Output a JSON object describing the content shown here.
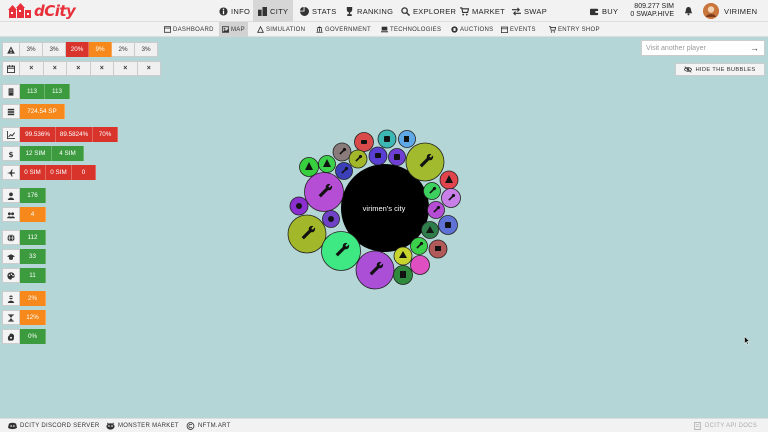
{
  "header": {
    "brand": "dCity",
    "nav": [
      {
        "label": "INFO",
        "icon": "info-icon"
      },
      {
        "label": "CITY",
        "icon": "city-icon",
        "active": true
      },
      {
        "label": "STATS",
        "icon": "stats-icon"
      },
      {
        "label": "RANKING",
        "icon": "trophy-icon"
      },
      {
        "label": "EXPLORER",
        "icon": "search-icon"
      },
      {
        "label": "MARKET",
        "icon": "cart-icon"
      },
      {
        "label": "SWAP",
        "icon": "swap-icon"
      },
      {
        "label": "BUY",
        "icon": "wallet-icon"
      }
    ],
    "balance_sim": "809.277 SIM",
    "balance_hive": "0 SWAP.HIVE",
    "username": "VIRIMEN"
  },
  "subnav": [
    {
      "label": "DASHBOARD",
      "icon": "dashboard-icon"
    },
    {
      "label": "MAP",
      "icon": "map-icon",
      "active": true
    },
    {
      "label": "SIMULATION",
      "icon": "simulation-icon"
    },
    {
      "label": "GOVERNMENT",
      "icon": "government-icon"
    },
    {
      "label": "TECHNOLOGIES",
      "icon": "technologies-icon"
    },
    {
      "label": "AUCTIONS",
      "icon": "auction-icon"
    },
    {
      "label": "EVENTS",
      "icon": "events-icon"
    },
    {
      "label": "ENTRY SHOP",
      "icon": "shop-icon"
    }
  ],
  "panel": {
    "risk": [
      "3%",
      "3%",
      "20%",
      "9%",
      "2%",
      "3%"
    ],
    "calendar": [
      "×",
      "×",
      "×",
      "×",
      "×",
      "×"
    ],
    "buildings": [
      "113",
      "113"
    ],
    "sp": "724.54 SP",
    "efficiency": [
      "99.536%",
      "89.5824%",
      "70%"
    ],
    "income": [
      "12 SIM",
      "4 SIM"
    ],
    "expense": [
      "0 SIM",
      "0 SIM",
      "0"
    ],
    "population": "176",
    "workers": "4",
    "education": "112",
    "students": "33",
    "tech": "11",
    "crime": "2%",
    "unemployment": "12%",
    "pollution": "0%"
  },
  "visit": {
    "placeholder": "Visit another player"
  },
  "hide_bubbles_label": "HIDE THE BUBBLES",
  "map": {
    "city_name": "virimen's city"
  },
  "footer": {
    "discord": "DCITY DISCORD SERVER",
    "monster": "MONSTER MARKET",
    "nftm": "NFTM.ART",
    "api": "DCITY API DOCS"
  },
  "colors": {
    "background": "#b5d6d6",
    "red": "#d8342c",
    "orange": "#f7891c",
    "green": "#3b9b3e",
    "brand": "#e8303a"
  }
}
